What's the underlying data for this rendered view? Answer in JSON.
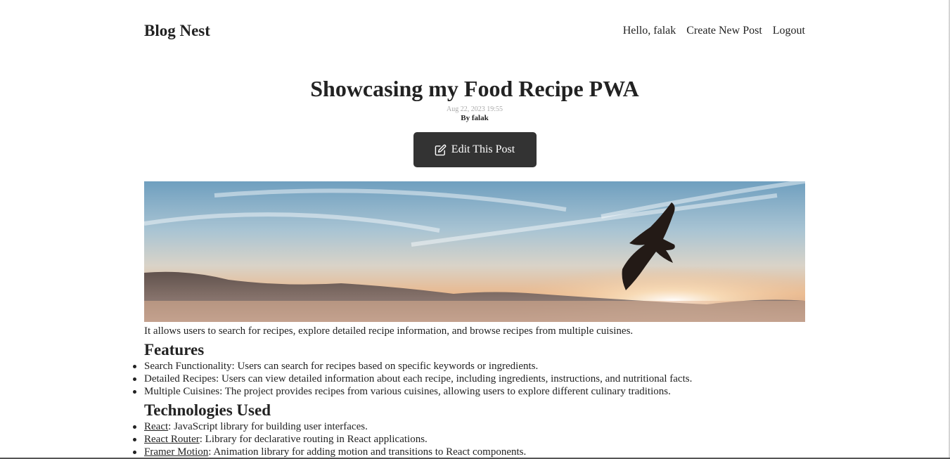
{
  "header": {
    "logo": "Blog Nest",
    "greeting": "Hello, falak",
    "nav": {
      "create": "Create New Post",
      "logout": "Logout"
    }
  },
  "post": {
    "title": "Showcasing my Food Recipe PWA",
    "time": "Aug 22, 2023 19:55",
    "author": "By falak",
    "edit_label": "Edit This Post",
    "intro": "It allows users to search for recipes, explore detailed recipe information, and browse recipes from multiple cuisines.",
    "features_heading": "Features",
    "features": [
      "Search Functionality: Users can search for recipes based on specific keywords or ingredients.",
      "Detailed Recipes: Users can view detailed information about each recipe, including ingredients, instructions, and nutritional facts.",
      "Multiple Cuisines: The project provides recipes from various cuisines, allowing users to explore different culinary traditions."
    ],
    "tech_heading": "Technologies Used",
    "technologies": [
      {
        "link": "React",
        "desc": ": JavaScript library for building user interfaces."
      },
      {
        "link": "React Router",
        "desc": ": Library for declarative routing in React applications."
      },
      {
        "link": "Framer Motion",
        "desc": ": Animation library for adding motion and transitions to React components."
      }
    ]
  },
  "icons": {
    "edit": "edit-icon"
  },
  "colors": {
    "button_bg": "#333333",
    "text": "#222222",
    "muted": "#aaaaaa"
  }
}
